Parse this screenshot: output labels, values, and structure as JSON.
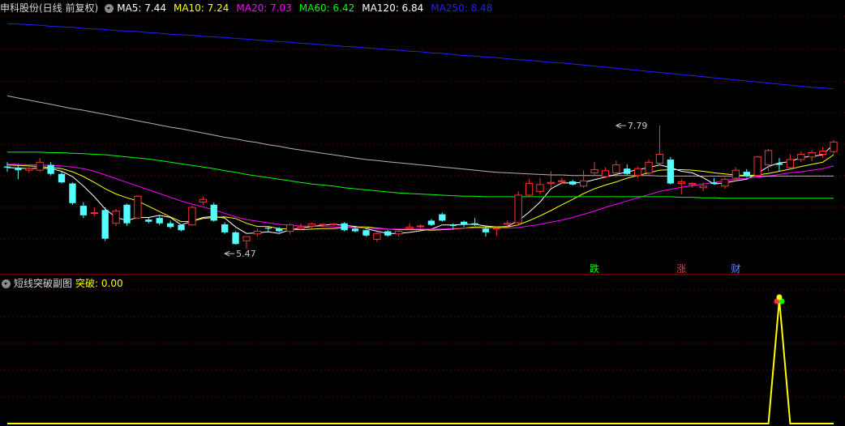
{
  "main_panel": {
    "title": "申科股份(日线 前复权)",
    "ma_labels": [
      {
        "label": "MA5: 7.44",
        "color": "#ffffff"
      },
      {
        "label": "MA10: 7.24",
        "color": "#ffff00"
      },
      {
        "label": "MA20: 7.03",
        "color": "#ff00ff"
      },
      {
        "label": "MA60: 6.42",
        "color": "#00ff00"
      },
      {
        "label": "MA120: 6.84",
        "color": "#ffffff"
      },
      {
        "label": "MA250: 8.48",
        "color": "#2020ff"
      }
    ]
  },
  "sub_panel": {
    "title": "短线突破副图",
    "value_label": "突破: 0.00"
  },
  "chart_data": [
    {
      "type": "candlestick",
      "title": "申科股份(日线 前复权)",
      "up_color": "#ff3232",
      "down_color": "#54ffff",
      "annotations": [
        {
          "text": "7.79",
          "color": "#c8c8c8",
          "candle_index": 56,
          "value": 7.79
        },
        {
          "text": "5.47",
          "color": "#c8c8c8",
          "candle_index": 20,
          "value": 5.47
        },
        {
          "text": "跌",
          "color": "#00ff00",
          "candle_index": 54
        },
        {
          "text": "涨",
          "color": "#ff3232",
          "candle_index": 62
        },
        {
          "text": "财",
          "color": "#5a8cff",
          "candle_index": 67
        }
      ],
      "candles": [
        [
          7.02,
          7.1,
          6.92,
          7.0
        ],
        [
          6.98,
          7.05,
          6.78,
          6.95
        ],
        [
          6.95,
          7.03,
          6.9,
          6.98
        ],
        [
          6.95,
          7.18,
          6.92,
          7.1
        ],
        [
          7.05,
          7.1,
          6.85,
          6.88
        ],
        [
          6.88,
          6.92,
          6.7,
          6.72
        ],
        [
          6.7,
          6.72,
          6.3,
          6.33
        ],
        [
          6.28,
          6.35,
          6.05,
          6.1
        ],
        [
          6.15,
          6.25,
          6.08,
          6.15
        ],
        [
          6.2,
          6.25,
          5.62,
          5.66
        ],
        [
          5.95,
          6.22,
          5.9,
          6.18
        ],
        [
          6.3,
          6.32,
          5.9,
          5.95
        ],
        [
          6.05,
          6.48,
          6.03,
          6.46
        ],
        [
          6.02,
          6.05,
          5.95,
          5.98
        ],
        [
          6.05,
          6.1,
          5.92,
          5.95
        ],
        [
          5.95,
          6.0,
          5.85,
          5.88
        ],
        [
          5.92,
          5.93,
          5.8,
          5.82
        ],
        [
          5.92,
          6.28,
          5.9,
          6.25
        ],
        [
          6.35,
          6.46,
          6.3,
          6.4
        ],
        [
          6.3,
          6.34,
          5.98,
          6.0
        ],
        [
          5.93,
          5.97,
          5.75,
          5.78
        ],
        [
          5.78,
          5.8,
          5.55,
          5.56
        ],
        [
          5.62,
          5.63,
          5.47,
          5.7
        ],
        [
          5.75,
          5.85,
          5.7,
          5.8
        ],
        [
          5.87,
          5.9,
          5.8,
          5.85
        ],
        [
          5.85,
          5.88,
          5.78,
          5.8
        ],
        [
          5.8,
          5.95,
          5.75,
          5.92
        ],
        [
          5.85,
          5.95,
          5.82,
          5.88
        ],
        [
          5.9,
          5.96,
          5.86,
          5.94
        ],
        [
          5.92,
          5.95,
          5.88,
          5.93
        ],
        [
          5.92,
          5.95,
          5.9,
          5.94
        ],
        [
          5.95,
          5.97,
          5.8,
          5.82
        ],
        [
          5.85,
          5.88,
          5.78,
          5.8
        ],
        [
          5.82,
          5.83,
          5.7,
          5.72
        ],
        [
          5.65,
          5.78,
          5.6,
          5.76
        ],
        [
          5.8,
          5.82,
          5.7,
          5.72
        ],
        [
          5.75,
          5.82,
          5.7,
          5.8
        ],
        [
          5.85,
          5.95,
          5.83,
          5.88
        ],
        [
          5.9,
          5.93,
          5.86,
          5.9
        ],
        [
          6.0,
          6.03,
          5.9,
          5.92
        ],
        [
          6.12,
          6.15,
          5.98,
          6.0
        ],
        [
          5.92,
          5.95,
          5.85,
          5.9
        ],
        [
          5.98,
          6.0,
          5.88,
          5.92
        ],
        [
          5.95,
          6.05,
          5.9,
          5.92
        ],
        [
          5.85,
          5.88,
          5.7,
          5.78
        ],
        [
          5.85,
          5.88,
          5.72,
          5.86
        ],
        [
          5.93,
          6.0,
          5.85,
          5.95
        ],
        [
          5.96,
          6.55,
          5.93,
          6.48
        ],
        [
          6.48,
          6.78,
          6.45,
          6.7
        ],
        [
          6.55,
          6.8,
          6.5,
          6.68
        ],
        [
          6.7,
          6.93,
          6.62,
          6.72
        ],
        [
          6.75,
          6.8,
          6.7,
          6.75
        ],
        [
          6.74,
          6.77,
          6.66,
          6.68
        ],
        [
          6.65,
          6.95,
          6.62,
          6.75
        ],
        [
          6.9,
          7.1,
          6.86,
          6.96
        ],
        [
          6.83,
          7.0,
          6.8,
          6.94
        ],
        [
          6.9,
          7.13,
          6.82,
          7.05
        ],
        [
          6.98,
          7.06,
          6.86,
          6.88
        ],
        [
          6.85,
          7.02,
          6.8,
          6.98
        ],
        [
          6.9,
          7.15,
          6.85,
          7.1
        ],
        [
          7.08,
          7.79,
          7.05,
          7.25
        ],
        [
          7.15,
          7.2,
          6.68,
          6.7
        ],
        [
          6.7,
          6.78,
          6.5,
          6.73
        ],
        [
          6.68,
          6.72,
          6.62,
          6.7
        ],
        [
          6.62,
          6.72,
          6.55,
          6.65
        ],
        [
          6.72,
          6.8,
          6.68,
          6.69
        ],
        [
          6.65,
          6.82,
          6.6,
          6.78
        ],
        [
          6.8,
          7.0,
          6.75,
          6.95
        ],
        [
          6.92,
          6.97,
          6.82,
          6.84
        ],
        [
          6.85,
          7.22,
          6.82,
          7.2
        ],
        [
          7.05,
          7.35,
          6.93,
          7.32
        ],
        [
          7.08,
          7.18,
          6.93,
          7.05
        ],
        [
          7.0,
          7.25,
          6.98,
          7.15
        ],
        [
          7.15,
          7.3,
          7.1,
          7.25
        ],
        [
          7.2,
          7.33,
          7.12,
          7.28
        ],
        [
          7.25,
          7.38,
          7.18,
          7.31
        ],
        [
          7.3,
          7.52,
          7.25,
          7.48
        ]
      ],
      "series": [
        {
          "name": "MA5",
          "color": "#ffffff",
          "values": [
            7.0,
            6.99,
            6.98,
            6.99,
            6.98,
            6.93,
            6.83,
            6.65,
            6.45,
            6.22,
            6.06,
            6.0,
            6.06,
            6.06,
            6.1,
            6.06,
            5.92,
            5.99,
            6.06,
            6.08,
            6.05,
            5.88,
            5.76,
            5.77,
            5.79,
            5.76,
            5.83,
            5.86,
            5.89,
            5.91,
            5.93,
            5.91,
            5.89,
            5.85,
            5.8,
            5.76,
            5.76,
            5.78,
            5.81,
            5.84,
            5.92,
            5.92,
            5.93,
            5.93,
            5.9,
            5.88,
            5.89,
            6.0,
            6.16,
            6.35,
            6.6,
            6.71,
            6.71,
            6.72,
            6.77,
            6.82,
            6.87,
            6.92,
            6.96,
            7.0,
            7.05,
            7.0,
            6.93,
            6.9,
            6.81,
            6.69,
            6.71,
            6.75,
            6.78,
            6.89,
            7.02,
            7.09,
            7.11,
            7.19,
            7.21,
            7.24,
            7.44
          ]
        },
        {
          "name": "MA10",
          "color": "#ffff00",
          "values": [
            7.05,
            7.04,
            7.03,
            7.02,
            7.0,
            6.98,
            6.92,
            6.83,
            6.72,
            6.6,
            6.5,
            6.43,
            6.37,
            6.27,
            6.17,
            6.07,
            5.98,
            5.99,
            6.04,
            6.06,
            6.07,
            6.04,
            5.95,
            5.89,
            5.89,
            5.85,
            5.84,
            5.83,
            5.84,
            5.85,
            5.85,
            5.87,
            5.88,
            5.88,
            5.86,
            5.84,
            5.83,
            5.83,
            5.83,
            5.82,
            5.83,
            5.84,
            5.86,
            5.88,
            5.88,
            5.88,
            5.88,
            5.92,
            6.0,
            6.09,
            6.19,
            6.3,
            6.4,
            6.51,
            6.6,
            6.67,
            6.73,
            6.8,
            6.85,
            6.9,
            6.95,
            6.96,
            6.96,
            6.95,
            6.93,
            6.9,
            6.88,
            6.86,
            6.85,
            6.86,
            6.89,
            6.93,
            6.97,
            7.02,
            7.06,
            7.1,
            7.24
          ]
        },
        {
          "name": "MA20",
          "color": "#ff00ff",
          "values": [
            7.06,
            7.06,
            7.05,
            7.05,
            7.04,
            7.03,
            7.01,
            6.98,
            6.93,
            6.86,
            6.79,
            6.72,
            6.65,
            6.58,
            6.51,
            6.44,
            6.37,
            6.31,
            6.26,
            6.2,
            6.14,
            6.07,
            6.02,
            5.99,
            5.96,
            5.93,
            5.91,
            5.9,
            5.89,
            5.89,
            5.88,
            5.88,
            5.87,
            5.86,
            5.85,
            5.84,
            5.84,
            5.84,
            5.84,
            5.84,
            5.84,
            5.85,
            5.86,
            5.86,
            5.86,
            5.86,
            5.86,
            5.87,
            5.9,
            5.93,
            5.97,
            6.01,
            6.06,
            6.12,
            6.18,
            6.25,
            6.31,
            6.37,
            6.43,
            6.49,
            6.55,
            6.59,
            6.63,
            6.66,
            6.69,
            6.72,
            6.75,
            6.78,
            6.8,
            6.82,
            6.84,
            6.87,
            6.9,
            6.92,
            6.95,
            6.98,
            7.03
          ]
        },
        {
          "name": "MA60",
          "color": "#00ff00",
          "values": [
            7.29,
            7.29,
            7.29,
            7.29,
            7.28,
            7.28,
            7.27,
            7.26,
            7.25,
            7.24,
            7.22,
            7.2,
            7.18,
            7.16,
            7.13,
            7.1,
            7.07,
            7.04,
            7.01,
            6.98,
            6.94,
            6.91,
            6.87,
            6.84,
            6.81,
            6.78,
            6.75,
            6.72,
            6.69,
            6.67,
            6.65,
            6.62,
            6.6,
            6.58,
            6.56,
            6.54,
            6.52,
            6.51,
            6.5,
            6.49,
            6.48,
            6.47,
            6.46,
            6.46,
            6.45,
            6.45,
            6.45,
            6.45,
            6.45,
            6.45,
            6.45,
            6.45,
            6.45,
            6.45,
            6.45,
            6.45,
            6.45,
            6.45,
            6.45,
            6.45,
            6.45,
            6.45,
            6.44,
            6.44,
            6.43,
            6.43,
            6.42,
            6.42,
            6.42,
            6.42,
            6.42,
            6.42,
            6.42,
            6.42,
            6.42,
            6.42,
            6.42
          ]
        },
        {
          "name": "MA120",
          "color": "#ffffff",
          "values": [
            8.35,
            8.31,
            8.27,
            8.23,
            8.19,
            8.15,
            8.11,
            8.08,
            8.04,
            8.0,
            7.96,
            7.92,
            7.88,
            7.84,
            7.8,
            7.76,
            7.73,
            7.69,
            7.65,
            7.61,
            7.57,
            7.54,
            7.5,
            7.47,
            7.43,
            7.4,
            7.36,
            7.33,
            7.3,
            7.27,
            7.24,
            7.21,
            7.18,
            7.15,
            7.13,
            7.11,
            7.09,
            7.07,
            7.05,
            7.03,
            7.01,
            6.99,
            6.97,
            6.95,
            6.93,
            6.91,
            6.9,
            6.89,
            6.88,
            6.87,
            6.86,
            6.86,
            6.85,
            6.85,
            6.85,
            6.85,
            6.85,
            6.85,
            6.85,
            6.85,
            6.84,
            6.84,
            6.84,
            6.84,
            6.84,
            6.84,
            6.84,
            6.84,
            6.84,
            6.84,
            6.84,
            6.84,
            6.84,
            6.84,
            6.84,
            6.84,
            6.84
          ]
        },
        {
          "name": "MA250",
          "color": "#2020ff",
          "values": [
            9.71,
            9.7,
            9.69,
            9.68,
            9.66,
            9.65,
            9.64,
            9.62,
            9.61,
            9.6,
            9.58,
            9.57,
            9.56,
            9.54,
            9.53,
            9.51,
            9.5,
            9.49,
            9.47,
            9.46,
            9.45,
            9.43,
            9.42,
            9.4,
            9.39,
            9.37,
            9.36,
            9.34,
            9.33,
            9.31,
            9.3,
            9.28,
            9.27,
            9.25,
            9.24,
            9.22,
            9.21,
            9.19,
            9.18,
            9.16,
            9.15,
            9.13,
            9.11,
            9.1,
            9.08,
            9.07,
            9.05,
            9.03,
            9.02,
            9.0,
            8.98,
            8.97,
            8.95,
            8.93,
            8.91,
            8.89,
            8.87,
            8.85,
            8.83,
            8.81,
            8.79,
            8.77,
            8.75,
            8.73,
            8.71,
            8.69,
            8.67,
            8.65,
            8.63,
            8.61,
            8.59,
            8.57,
            8.55,
            8.53,
            8.51,
            8.5,
            8.48
          ]
        }
      ]
    },
    {
      "type": "line",
      "title": "短线突破副图",
      "series": [
        {
          "name": "突破",
          "color": "#ffff00",
          "values": [
            0,
            0,
            0,
            0,
            0,
            0,
            0,
            0,
            0,
            0,
            0,
            0,
            0,
            0,
            0,
            0,
            0,
            0,
            0,
            0,
            0,
            0,
            0,
            0,
            0,
            0,
            0,
            0,
            0,
            0,
            0,
            0,
            0,
            0,
            0,
            0,
            0,
            0,
            0,
            0,
            0,
            0,
            0,
            0,
            0,
            0,
            0,
            0,
            0,
            0,
            0,
            0,
            0,
            0,
            0,
            0,
            0,
            0,
            0,
            0,
            0,
            0,
            0,
            0,
            0,
            0,
            0,
            0,
            0,
            0,
            0,
            1,
            0,
            0,
            0,
            0,
            0
          ]
        }
      ],
      "ylim": [
        0,
        1
      ],
      "signal_dot_colors": [
        "#ff3232",
        "#00ff00",
        "#ffff00"
      ]
    }
  ]
}
